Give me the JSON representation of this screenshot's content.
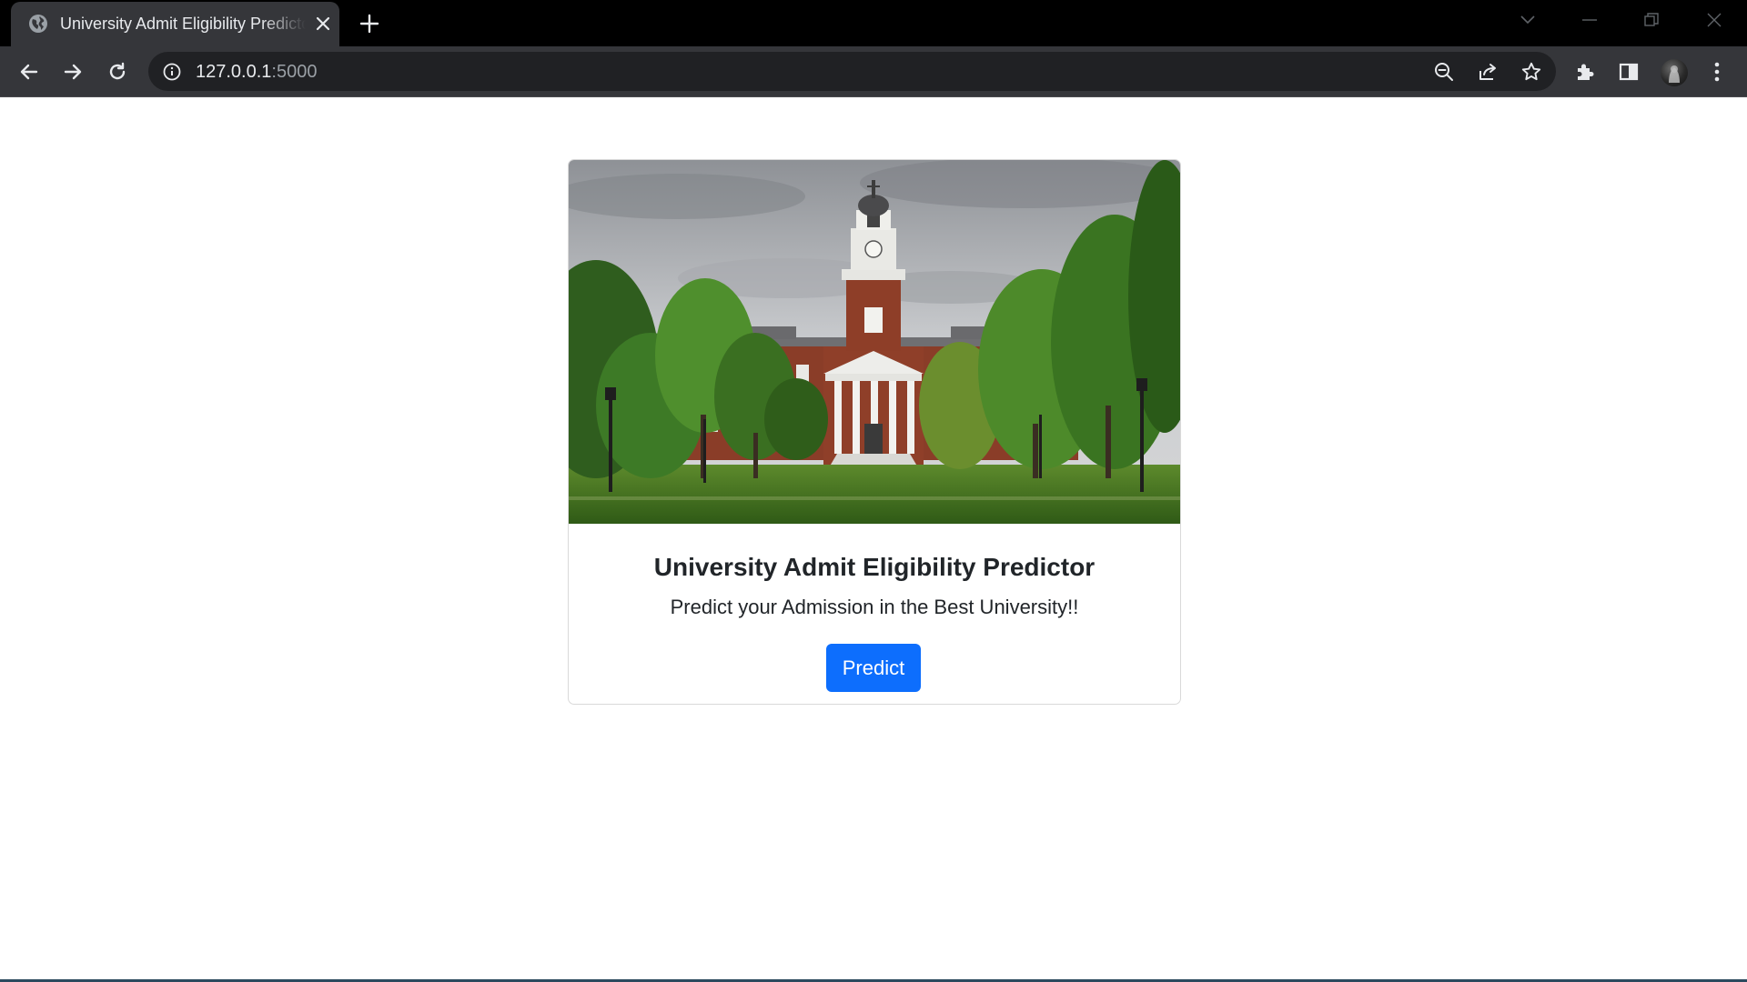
{
  "browser": {
    "tab": {
      "title": "University Admit Eligibility Predictor",
      "favicon": "globe-icon"
    },
    "new_tab_icon": "plus-icon",
    "address": {
      "host": "127.0.0.1",
      "port": ":5000",
      "info_icon": "info-icon"
    },
    "omnibox_icons": [
      "zoom-out-icon",
      "share-icon",
      "star-icon"
    ],
    "toolbar_icons": [
      "extensions-icon",
      "side-panel-icon",
      "profile-avatar",
      "menu-icon"
    ],
    "window_controls": [
      "tab-search-icon",
      "minimize-icon",
      "restore-icon",
      "close-icon"
    ]
  },
  "card": {
    "image_description_icon": "university-campus-photo",
    "title": "University Admit Eligibility Predictor",
    "subtitle": "Predict your Admission in the Best University!!",
    "button_label": "Predict"
  },
  "colors": {
    "primary_button": "#0d6efd",
    "chrome_dark": "#35363a",
    "tabstrip": "#000000",
    "omnibox": "#202124"
  }
}
